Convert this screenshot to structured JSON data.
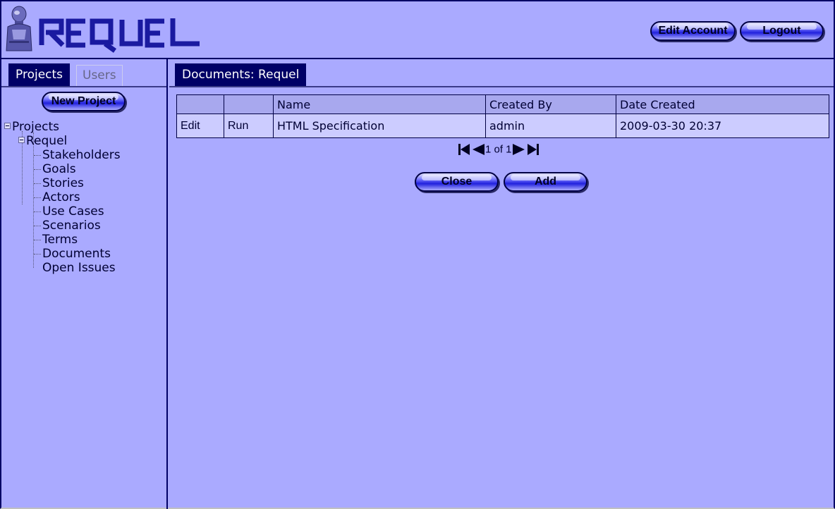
{
  "header": {
    "logo_text": "REQUEL",
    "edit_account_label": "Edit Account",
    "logout_label": "Logout"
  },
  "sidebar": {
    "tabs": [
      {
        "label": "Projects",
        "active": true
      },
      {
        "label": "Users",
        "active": false
      }
    ],
    "new_project_label": "New Project",
    "tree": {
      "root": "Projects",
      "project": "Requel",
      "items": [
        "Stakeholders",
        "Goals",
        "Stories",
        "Actors",
        "Use Cases",
        "Scenarios",
        "Terms",
        "Documents",
        "Open Issues"
      ]
    }
  },
  "main": {
    "tab_label": "Documents: Requel",
    "table": {
      "columns": [
        "",
        "",
        "Name",
        "Created By",
        "Date Created"
      ],
      "rows": [
        {
          "edit": "Edit",
          "run": "Run",
          "name": "HTML Specification",
          "created_by": "admin",
          "date_created": "2009-03-30 20:37"
        }
      ]
    },
    "pager": {
      "text": "1 of 1"
    },
    "close_label": "Close",
    "add_label": "Add"
  },
  "colors": {
    "background": "#aaaaff",
    "dark": "#000066",
    "cell": "#ccccff",
    "header_cell": "#a8a8ee"
  },
  "icons": [
    "robot-logo-icon",
    "first-page-icon",
    "prev-page-icon",
    "next-page-icon",
    "last-page-icon",
    "tree-collapse-icon"
  ]
}
